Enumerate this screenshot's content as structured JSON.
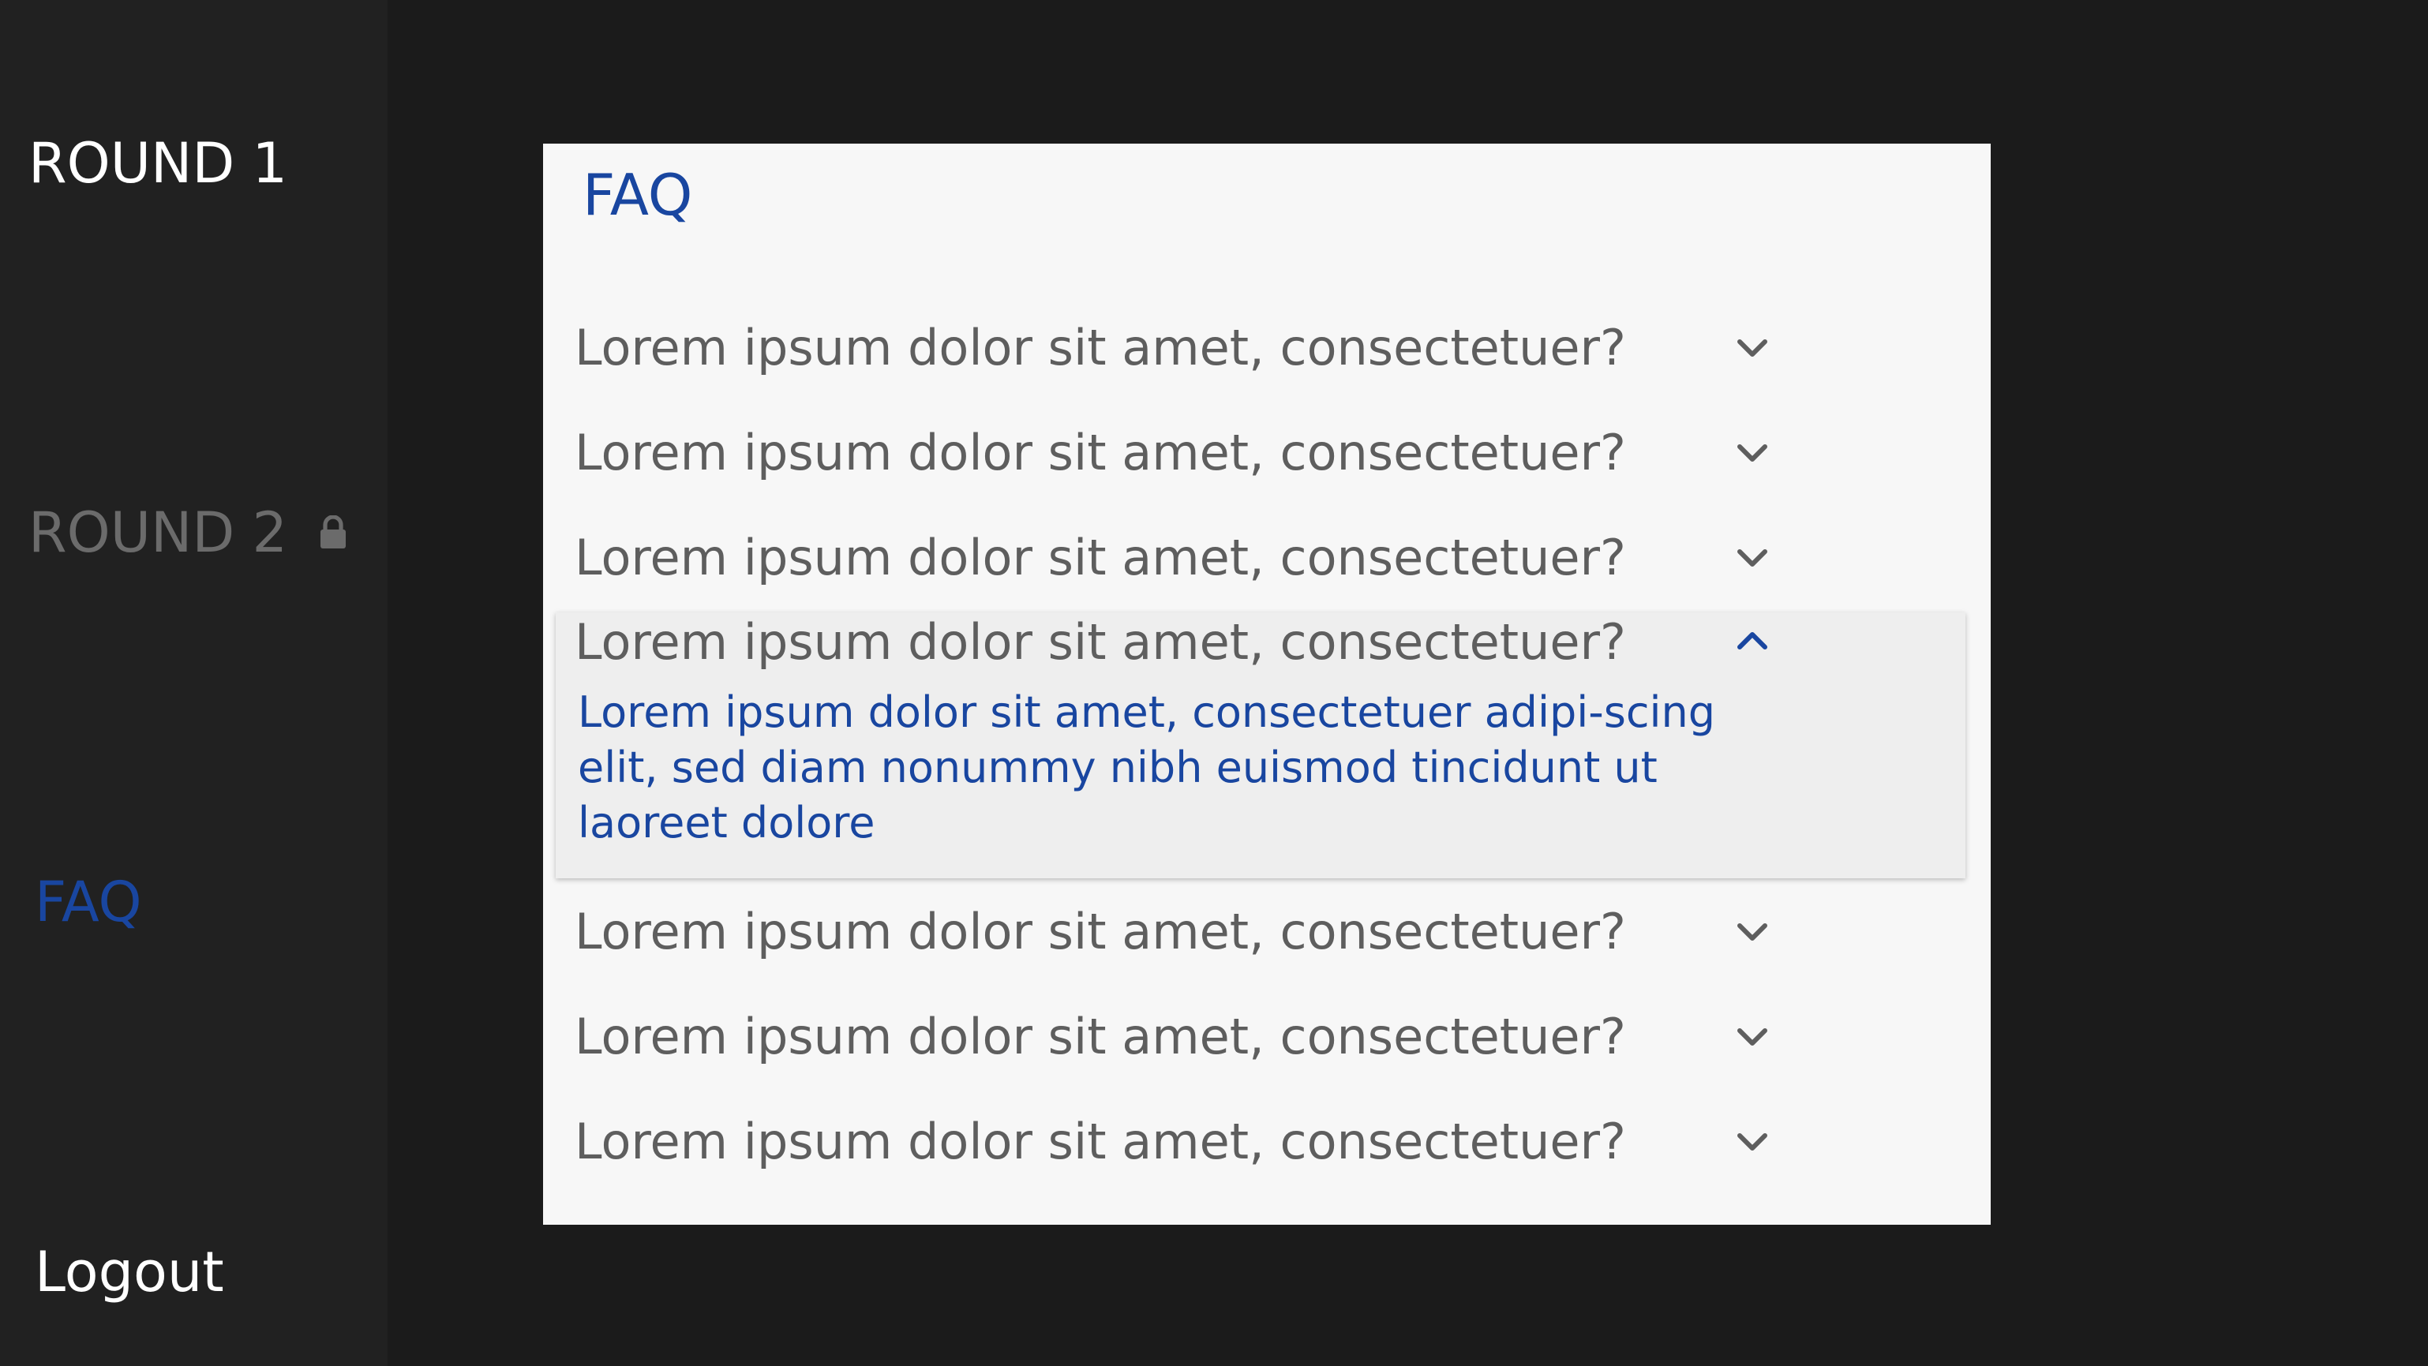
{
  "sidebar": {
    "round1": "ROUND 1",
    "round2": "ROUND 2",
    "round2_icon": "lock-icon",
    "faq": "FAQ",
    "logout": "Logout"
  },
  "panel": {
    "title": "FAQ",
    "items": [
      {
        "question": "Lorem ipsum dolor sit amet, consectetuer?",
        "expanded": false
      },
      {
        "question": "Lorem ipsum dolor sit amet, consectetuer?",
        "expanded": false
      },
      {
        "question": "Lorem ipsum dolor sit amet, consectetuer?",
        "expanded": false
      },
      {
        "question": "Lorem ipsum dolor sit amet, consectetuer?",
        "expanded": true,
        "answer": "Lorem ipsum dolor sit amet, consectetuer adipi-scing elit, sed diam nonummy nibh euismod tincidunt ut laoreet dolore"
      },
      {
        "question": "Lorem ipsum dolor sit amet, consectetuer?",
        "expanded": false
      },
      {
        "question": "Lorem ipsum dolor sit amet, consectetuer?",
        "expanded": false
      },
      {
        "question": "Lorem ipsum dolor sit amet, consectetuer?",
        "expanded": false
      }
    ]
  },
  "colors": {
    "background": "#1b1b1b",
    "sidebar": "#212121",
    "accent": "#1946a0",
    "muted": "#6b6b6b",
    "question_text": "#5e5e5e",
    "panel": "#f7f7f7"
  }
}
